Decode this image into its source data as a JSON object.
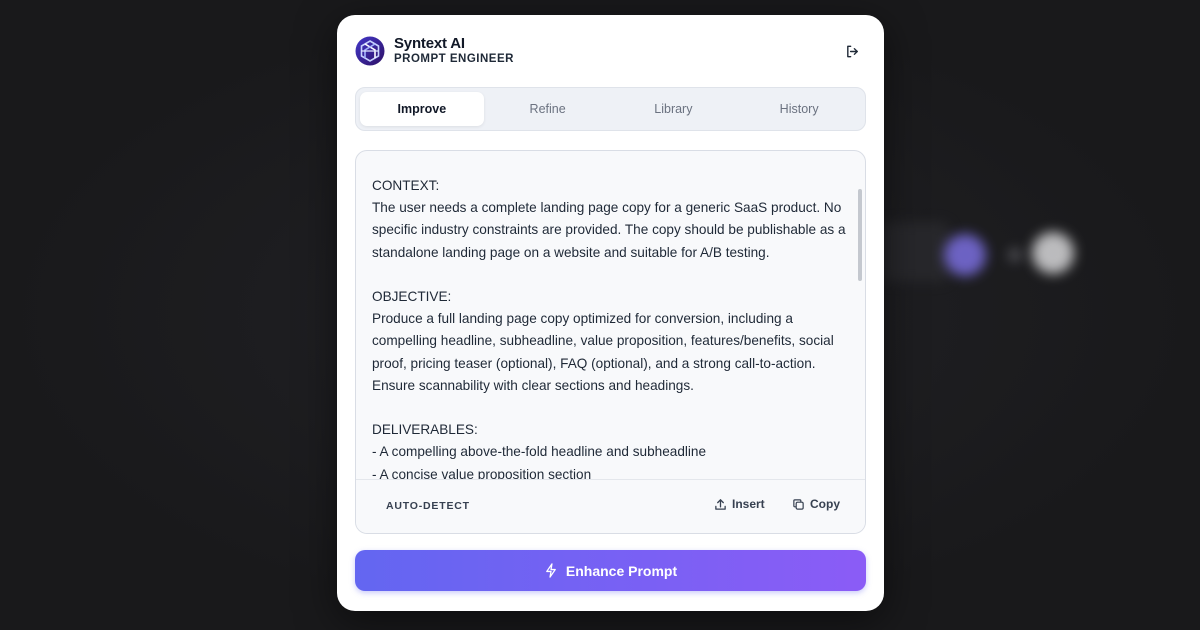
{
  "app": {
    "name": "Syntext AI",
    "subtitle": "PROMPT ENGINEER",
    "logo_icon": "hexagon-knot-logo",
    "brand_colors": [
      "#2e1065",
      "#6366f1",
      "#8b5cf6"
    ]
  },
  "header": {
    "logout_icon": "logout-icon"
  },
  "tabs": [
    {
      "label": "Improve",
      "active": true
    },
    {
      "label": "Refine",
      "active": false
    },
    {
      "label": "Library",
      "active": false
    },
    {
      "label": "History",
      "active": false
    }
  ],
  "editor": {
    "content": "CONTEXT:\nThe user needs a complete landing page copy for a generic SaaS product. No specific industry constraints are provided. The copy should be publishable as a standalone landing page on a website and suitable for A/B testing.\n\nOBJECTIVE:\nProduce a full landing page copy optimized for conversion, including a compelling headline, subheadline, value proposition, features/benefits, social proof, pricing teaser (optional), FAQ (optional), and a strong call-to-action. Ensure scannability with clear sections and headings.\n\nDELIVERABLES:\n- A compelling above-the-fold headline and subheadline\n- A concise value proposition section",
    "language_mode": "AUTO-DETECT",
    "insert_label": "Insert",
    "insert_icon": "upload-icon",
    "copy_label": "Copy",
    "copy_icon": "copy-icon"
  },
  "action": {
    "enhance_label": "Enhance Prompt",
    "enhance_icon": "lightning-icon",
    "gradient": [
      "#6366f1",
      "#8b5cf6"
    ]
  }
}
